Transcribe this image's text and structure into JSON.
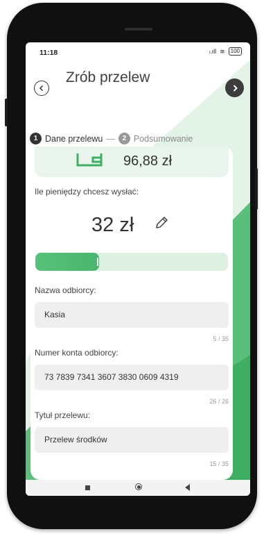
{
  "status_bar": {
    "time": "11:18",
    "signal": "ₗ.ıll",
    "wifi": "≋",
    "battery": "100"
  },
  "header": {
    "back_label": "‹",
    "title": "Zrób przelew",
    "next_label": "›"
  },
  "steps": [
    {
      "number": "1",
      "label": "Dane przelewu",
      "active": true
    },
    {
      "number": "2",
      "label": "Podsumowanie",
      "active": false
    }
  ],
  "step_separator": "—",
  "balance": {
    "value": "96,88 zł",
    "icon": "wallet-icon"
  },
  "amount": {
    "label": "Ile pieniędzy chcesz wysłać:",
    "value": "32 zł",
    "icon": "pencil-icon",
    "slider_fraction": 0.33
  },
  "form": {
    "recipient_name": {
      "label": "Nazwa odbiorcy:",
      "value": "Kasia",
      "counter": "5 / 35"
    },
    "account_number": {
      "label": "Numer konta odbiorcy:",
      "value": "73 7839 7341 3607 3830 0609 4319",
      "counter": "26 / 26"
    },
    "title": {
      "label": "Tytuł przelewu:",
      "value": "Przelew środków",
      "counter": "15 / 35"
    }
  },
  "colors": {
    "brand_green": "#4ab56d",
    "light_green": "#ddf0e1",
    "dark": "#333333"
  },
  "nav_bar": {
    "items": [
      "recents-icon",
      "home-icon",
      "back-icon"
    ]
  }
}
